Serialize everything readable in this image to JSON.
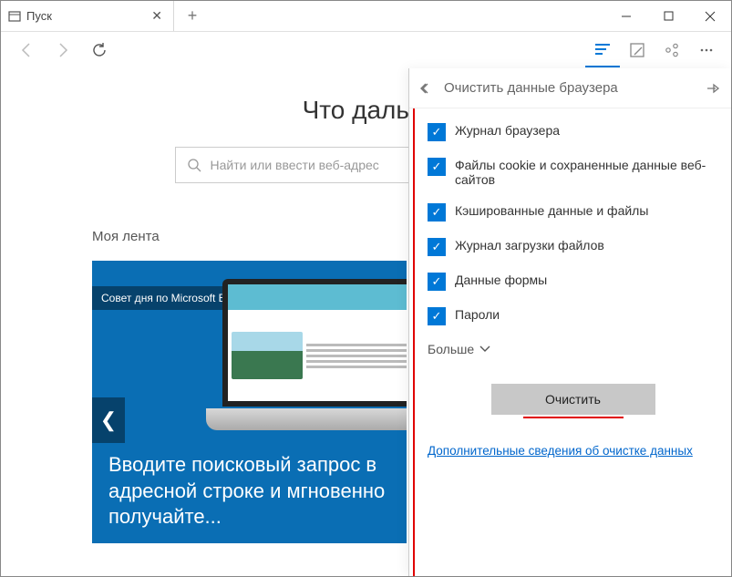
{
  "tab": {
    "title": "Пуск"
  },
  "page": {
    "heading": "Что дальш",
    "search_placeholder": "Найти или ввести веб-адрес",
    "feed_label": "Моя лента",
    "card_badge": "Совет дня по Microsoft Edge",
    "card_text": "Вводите поисковый запрос в адресной строке и мгновенно получайте..."
  },
  "panel": {
    "title": "Очистить данные браузера",
    "items": [
      "Журнал браузера",
      "Файлы cookie и сохраненные данные веб-сайтов",
      "Кэшированные данные и файлы",
      "Журнал загрузки файлов",
      "Данные формы",
      "Пароли"
    ],
    "more_label": "Больше",
    "clear_button": "Очистить",
    "more_info": "Дополнительные сведения об очистке данных"
  }
}
